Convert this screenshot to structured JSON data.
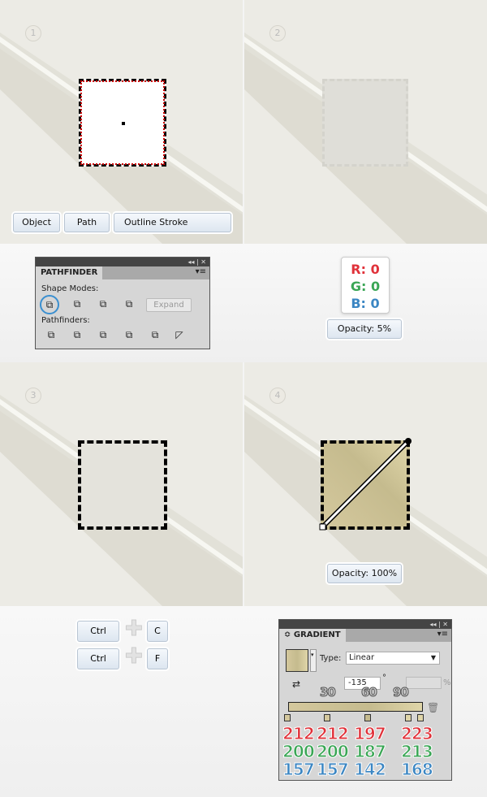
{
  "steps": [
    "1",
    "2",
    "3",
    "4"
  ],
  "step1": {
    "buttons": [
      "Object",
      "Path",
      "Outline Stroke"
    ]
  },
  "pathfinder": {
    "title": "PATHFINDER",
    "shape_modes": "Shape Modes:",
    "expand": "Expand",
    "pathfinders": "Pathfinders:",
    "controls": "◂◂ | ✕",
    "menu": "▾≡"
  },
  "rgb": {
    "r": "R: 0",
    "g": "G: 0",
    "b": "B: 0",
    "opacity": "Opacity: 5%"
  },
  "step4": {
    "opacity": "Opacity: 100%"
  },
  "shortcuts": {
    "ctrl": "Ctrl",
    "c": "C",
    "f": "F"
  },
  "gradient": {
    "title": "≎ GRADIENT",
    "type_label": "Type:",
    "type_value": "Linear",
    "angle": "-135",
    "degree": "°",
    "percent": "%",
    "midpoints": [
      "30",
      "60",
      "90"
    ],
    "red": [
      "212",
      "212",
      "197",
      "223"
    ],
    "green": [
      "200",
      "200",
      "187",
      "213"
    ],
    "blue": [
      "157",
      "157",
      "142",
      "168"
    ],
    "colors": {
      "red": "#e0323a",
      "green": "#3aa655",
      "blue": "#3b86c3"
    }
  }
}
